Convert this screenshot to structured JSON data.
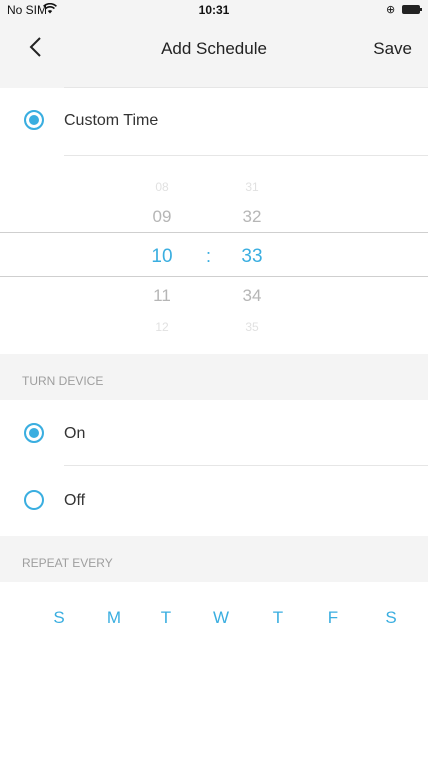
{
  "status_bar": {
    "carrier": "No SIM",
    "time": "10:31"
  },
  "nav": {
    "title": "Add Schedule",
    "save_label": "Save"
  },
  "time_mode": {
    "label": "Custom Time",
    "selected": true
  },
  "time_picker": {
    "hours": [
      "08",
      "09",
      "10",
      "11",
      "12"
    ],
    "minutes": [
      "31",
      "32",
      "33",
      "34",
      "35"
    ],
    "separator": ":",
    "selected_hour": "10",
    "selected_minute": "33"
  },
  "turn_device": {
    "header": "TURN DEVICE",
    "options": [
      {
        "label": "On",
        "selected": true
      },
      {
        "label": "Off",
        "selected": false
      }
    ]
  },
  "repeat": {
    "header": "REPEAT EVERY",
    "days": [
      "S",
      "M",
      "T",
      "W",
      "T",
      "F",
      "S"
    ]
  },
  "colors": {
    "accent": "#3aaee0",
    "background_gray": "#f4f4f4"
  }
}
